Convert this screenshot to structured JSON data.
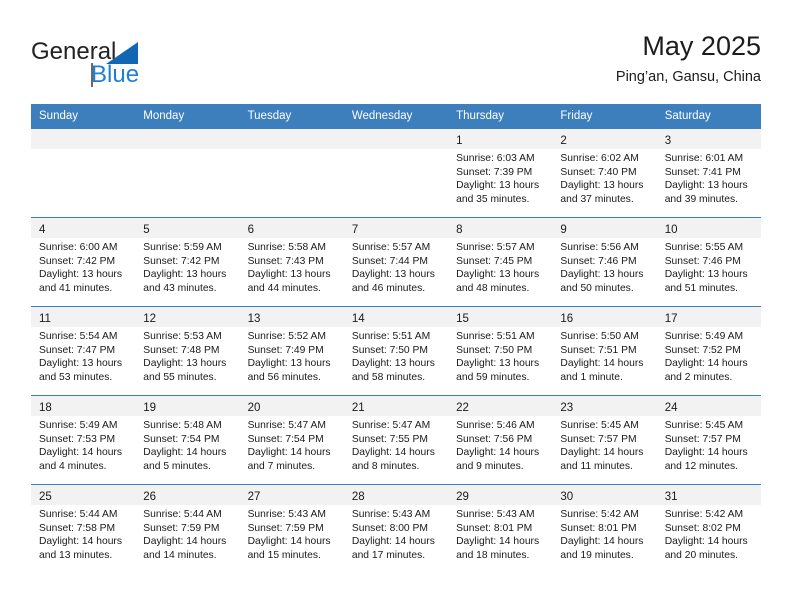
{
  "brand": {
    "name_top": "General",
    "name_bottom": "Blue",
    "accent_color": "#1167b1",
    "blue_text_color": "#1f7fd4"
  },
  "header": {
    "title": "May 2025",
    "subtitle": "Ping’an, Gansu, China"
  },
  "calendar": {
    "header_bg": "#3d7ebd",
    "weekdays": [
      "Sunday",
      "Monday",
      "Tuesday",
      "Wednesday",
      "Thursday",
      "Friday",
      "Saturday"
    ],
    "weeks": [
      [
        {
          "day": "",
          "empty": true
        },
        {
          "day": "",
          "empty": true
        },
        {
          "day": "",
          "empty": true
        },
        {
          "day": "",
          "empty": true
        },
        {
          "day": "1",
          "sunrise": "Sunrise: 6:03 AM",
          "sunset": "Sunset: 7:39 PM",
          "daylight_line1": "Daylight: 13 hours",
          "daylight_line2": "and 35 minutes."
        },
        {
          "day": "2",
          "sunrise": "Sunrise: 6:02 AM",
          "sunset": "Sunset: 7:40 PM",
          "daylight_line1": "Daylight: 13 hours",
          "daylight_line2": "and 37 minutes."
        },
        {
          "day": "3",
          "sunrise": "Sunrise: 6:01 AM",
          "sunset": "Sunset: 7:41 PM",
          "daylight_line1": "Daylight: 13 hours",
          "daylight_line2": "and 39 minutes."
        }
      ],
      [
        {
          "day": "4",
          "sunrise": "Sunrise: 6:00 AM",
          "sunset": "Sunset: 7:42 PM",
          "daylight_line1": "Daylight: 13 hours",
          "daylight_line2": "and 41 minutes."
        },
        {
          "day": "5",
          "sunrise": "Sunrise: 5:59 AM",
          "sunset": "Sunset: 7:42 PM",
          "daylight_line1": "Daylight: 13 hours",
          "daylight_line2": "and 43 minutes."
        },
        {
          "day": "6",
          "sunrise": "Sunrise: 5:58 AM",
          "sunset": "Sunset: 7:43 PM",
          "daylight_line1": "Daylight: 13 hours",
          "daylight_line2": "and 44 minutes."
        },
        {
          "day": "7",
          "sunrise": "Sunrise: 5:57 AM",
          "sunset": "Sunset: 7:44 PM",
          "daylight_line1": "Daylight: 13 hours",
          "daylight_line2": "and 46 minutes."
        },
        {
          "day": "8",
          "sunrise": "Sunrise: 5:57 AM",
          "sunset": "Sunset: 7:45 PM",
          "daylight_line1": "Daylight: 13 hours",
          "daylight_line2": "and 48 minutes."
        },
        {
          "day": "9",
          "sunrise": "Sunrise: 5:56 AM",
          "sunset": "Sunset: 7:46 PM",
          "daylight_line1": "Daylight: 13 hours",
          "daylight_line2": "and 50 minutes."
        },
        {
          "day": "10",
          "sunrise": "Sunrise: 5:55 AM",
          "sunset": "Sunset: 7:46 PM",
          "daylight_line1": "Daylight: 13 hours",
          "daylight_line2": "and 51 minutes."
        }
      ],
      [
        {
          "day": "11",
          "sunrise": "Sunrise: 5:54 AM",
          "sunset": "Sunset: 7:47 PM",
          "daylight_line1": "Daylight: 13 hours",
          "daylight_line2": "and 53 minutes."
        },
        {
          "day": "12",
          "sunrise": "Sunrise: 5:53 AM",
          "sunset": "Sunset: 7:48 PM",
          "daylight_line1": "Daylight: 13 hours",
          "daylight_line2": "and 55 minutes."
        },
        {
          "day": "13",
          "sunrise": "Sunrise: 5:52 AM",
          "sunset": "Sunset: 7:49 PM",
          "daylight_line1": "Daylight: 13 hours",
          "daylight_line2": "and 56 minutes."
        },
        {
          "day": "14",
          "sunrise": "Sunrise: 5:51 AM",
          "sunset": "Sunset: 7:50 PM",
          "daylight_line1": "Daylight: 13 hours",
          "daylight_line2": "and 58 minutes."
        },
        {
          "day": "15",
          "sunrise": "Sunrise: 5:51 AM",
          "sunset": "Sunset: 7:50 PM",
          "daylight_line1": "Daylight: 13 hours",
          "daylight_line2": "and 59 minutes."
        },
        {
          "day": "16",
          "sunrise": "Sunrise: 5:50 AM",
          "sunset": "Sunset: 7:51 PM",
          "daylight_line1": "Daylight: 14 hours",
          "daylight_line2": "and 1 minute."
        },
        {
          "day": "17",
          "sunrise": "Sunrise: 5:49 AM",
          "sunset": "Sunset: 7:52 PM",
          "daylight_line1": "Daylight: 14 hours",
          "daylight_line2": "and 2 minutes."
        }
      ],
      [
        {
          "day": "18",
          "sunrise": "Sunrise: 5:49 AM",
          "sunset": "Sunset: 7:53 PM",
          "daylight_line1": "Daylight: 14 hours",
          "daylight_line2": "and 4 minutes."
        },
        {
          "day": "19",
          "sunrise": "Sunrise: 5:48 AM",
          "sunset": "Sunset: 7:54 PM",
          "daylight_line1": "Daylight: 14 hours",
          "daylight_line2": "and 5 minutes."
        },
        {
          "day": "20",
          "sunrise": "Sunrise: 5:47 AM",
          "sunset": "Sunset: 7:54 PM",
          "daylight_line1": "Daylight: 14 hours",
          "daylight_line2": "and 7 minutes."
        },
        {
          "day": "21",
          "sunrise": "Sunrise: 5:47 AM",
          "sunset": "Sunset: 7:55 PM",
          "daylight_line1": "Daylight: 14 hours",
          "daylight_line2": "and 8 minutes."
        },
        {
          "day": "22",
          "sunrise": "Sunrise: 5:46 AM",
          "sunset": "Sunset: 7:56 PM",
          "daylight_line1": "Daylight: 14 hours",
          "daylight_line2": "and 9 minutes."
        },
        {
          "day": "23",
          "sunrise": "Sunrise: 5:45 AM",
          "sunset": "Sunset: 7:57 PM",
          "daylight_line1": "Daylight: 14 hours",
          "daylight_line2": "and 11 minutes."
        },
        {
          "day": "24",
          "sunrise": "Sunrise: 5:45 AM",
          "sunset": "Sunset: 7:57 PM",
          "daylight_line1": "Daylight: 14 hours",
          "daylight_line2": "and 12 minutes."
        }
      ],
      [
        {
          "day": "25",
          "sunrise": "Sunrise: 5:44 AM",
          "sunset": "Sunset: 7:58 PM",
          "daylight_line1": "Daylight: 14 hours",
          "daylight_line2": "and 13 minutes."
        },
        {
          "day": "26",
          "sunrise": "Sunrise: 5:44 AM",
          "sunset": "Sunset: 7:59 PM",
          "daylight_line1": "Daylight: 14 hours",
          "daylight_line2": "and 14 minutes."
        },
        {
          "day": "27",
          "sunrise": "Sunrise: 5:43 AM",
          "sunset": "Sunset: 7:59 PM",
          "daylight_line1": "Daylight: 14 hours",
          "daylight_line2": "and 15 minutes."
        },
        {
          "day": "28",
          "sunrise": "Sunrise: 5:43 AM",
          "sunset": "Sunset: 8:00 PM",
          "daylight_line1": "Daylight: 14 hours",
          "daylight_line2": "and 17 minutes."
        },
        {
          "day": "29",
          "sunrise": "Sunrise: 5:43 AM",
          "sunset": "Sunset: 8:01 PM",
          "daylight_line1": "Daylight: 14 hours",
          "daylight_line2": "and 18 minutes."
        },
        {
          "day": "30",
          "sunrise": "Sunrise: 5:42 AM",
          "sunset": "Sunset: 8:01 PM",
          "daylight_line1": "Daylight: 14 hours",
          "daylight_line2": "and 19 minutes."
        },
        {
          "day": "31",
          "sunrise": "Sunrise: 5:42 AM",
          "sunset": "Sunset: 8:02 PM",
          "daylight_line1": "Daylight: 14 hours",
          "daylight_line2": "and 20 minutes."
        }
      ]
    ]
  }
}
